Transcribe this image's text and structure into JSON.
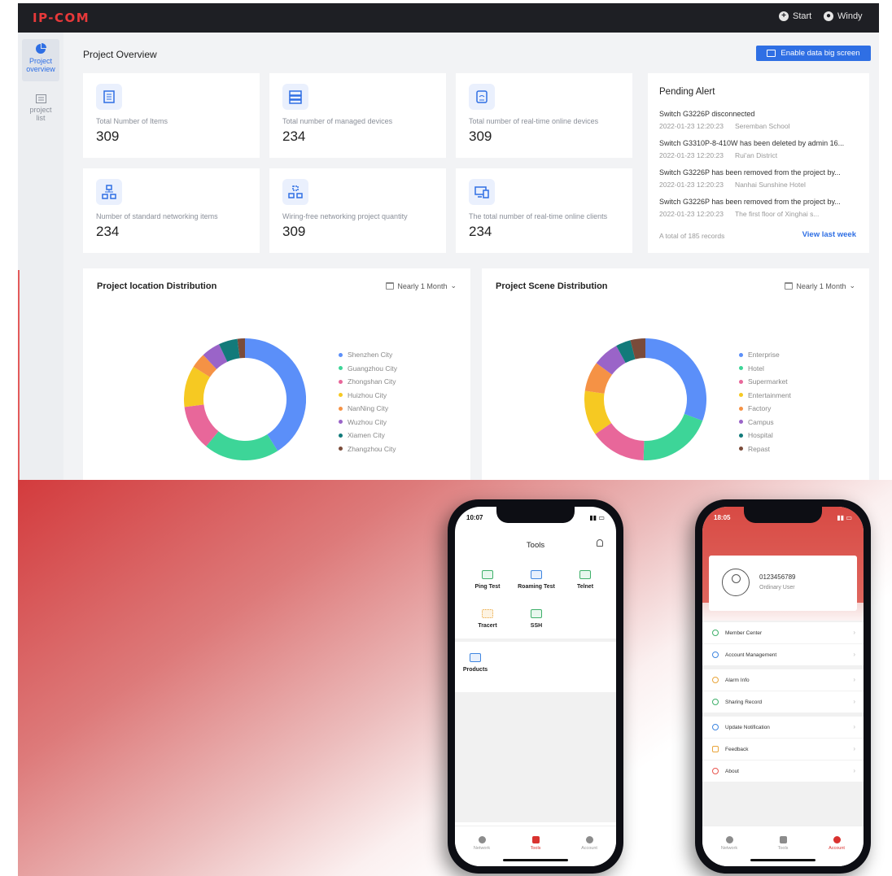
{
  "topbar": {
    "logo": "IP-COM",
    "start_label": "Start",
    "user_label": "Windy"
  },
  "sidebar": {
    "items": [
      {
        "label_1": "Project",
        "label_2": "overview"
      },
      {
        "label_1": "project",
        "label_2": "list"
      }
    ]
  },
  "main": {
    "title": "Project Overview",
    "big_screen_label": "Enable data big screen",
    "stats": [
      {
        "label": "Total Number of Items",
        "value": "309",
        "icon": "list-icon"
      },
      {
        "label": "Total number of managed devices",
        "value": "234",
        "icon": "server-icon"
      },
      {
        "label": "Total number of real-time online devices",
        "value": "309",
        "icon": "router-icon"
      },
      {
        "label": "Number of standard networking items",
        "value": "234",
        "icon": "network-icon"
      },
      {
        "label": "Wiring-free networking project quantity",
        "value": "309",
        "icon": "wireless-icon"
      },
      {
        "label": "The total number of real-time online clients",
        "value": "234",
        "icon": "clients-icon"
      }
    ],
    "alert": {
      "title": "Pending Alert",
      "items": [
        {
          "text": "Switch G3226P disconnected",
          "time": "2022-01-23  12:20:23",
          "place": "Seremban School"
        },
        {
          "text": "Switch G3310P-8-410W has been deleted by admin 16...",
          "time": "2022-01-23  12:20:23",
          "place": "Rui'an District"
        },
        {
          "text": "Switch G3226P has been removed from the project by...",
          "time": "2022-01-23  12:20:23",
          "place": "Nanhai Sunshine Hotel"
        },
        {
          "text": "Switch G3226P has been removed from the project by...",
          "time": "2022-01-23  12:20:23",
          "place": "The first floor of Xinghai s..."
        }
      ],
      "total": "A total of 185 records",
      "link": "View last week"
    },
    "location_card": {
      "title": "Project location Distribution",
      "filter": "Nearly 1 Month"
    },
    "scene_card": {
      "title": "Project Scene Distribution",
      "filter": "Nearly 1 Month"
    }
  },
  "colors": {
    "accent": "#2f6fe4",
    "brand_red": "#e9393a",
    "palette": [
      "#5b8ff9",
      "#3dd598",
      "#e8679a",
      "#f6c922",
      "#f59245",
      "#9a64c8",
      "#127a7a",
      "#7a4b3a"
    ]
  },
  "chart_data": [
    {
      "type": "pie",
      "donut": true,
      "title": "Project location Distribution",
      "categories": [
        "Shenzhen City",
        "Guangzhou City",
        "Zhongshan City",
        "Huizhou City",
        "NanNing City",
        "Wuzhou City",
        "Xiamen City",
        "Zhangzhou City"
      ],
      "values": [
        41,
        20,
        12,
        11,
        4,
        5,
        5,
        2
      ],
      "legend": "right"
    },
    {
      "type": "pie",
      "donut": true,
      "title": "Project Scene Distribution",
      "categories": [
        "Enterprise",
        "Hotel",
        "Supermarket",
        "Entertainment",
        "Factory",
        "Campus",
        "Hospital",
        "Repast"
      ],
      "values": [
        31,
        20,
        15,
        12,
        8,
        7,
        4,
        4
      ],
      "legend": "right"
    }
  ],
  "phone_tools": {
    "time": "10:07",
    "title": "Tools",
    "tools": [
      "Ping Test",
      "Roaming Test",
      "Telnet",
      "Tracert",
      "SSH",
      "Products"
    ],
    "tabs": [
      "Network",
      "Tools",
      "Account"
    ]
  },
  "phone_account": {
    "time": "18:05",
    "account_number": "0123456789",
    "role": "Ordinary User",
    "menu": [
      "Member Center",
      "Account Management",
      "Alarm Info",
      "Sharing Record",
      "Update Notification",
      "Feedback",
      "About"
    ],
    "tabs": [
      "Network",
      "Tools",
      "Account"
    ]
  }
}
